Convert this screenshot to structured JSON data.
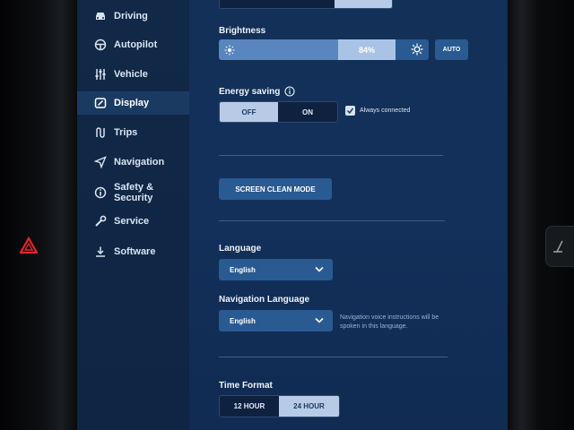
{
  "sidebar": {
    "items": [
      {
        "label": "Driving",
        "icon": "car-icon"
      },
      {
        "label": "Autopilot",
        "icon": "steering-wheel-icon"
      },
      {
        "label": "Vehicle",
        "icon": "sliders-icon"
      },
      {
        "label": "Display",
        "icon": "display-icon",
        "active": true
      },
      {
        "label": "Trips",
        "icon": "trips-icon"
      },
      {
        "label": "Navigation",
        "icon": "navigation-arrow-icon"
      },
      {
        "label": "Safety &",
        "label2": "Security",
        "icon": "info-circle-icon"
      },
      {
        "label": "Service",
        "icon": "wrench-icon"
      },
      {
        "label": "Software",
        "icon": "download-icon"
      }
    ]
  },
  "brightness": {
    "label": "Brightness",
    "value_text": "84%",
    "level": 0.84,
    "auto_label": "AUTO"
  },
  "energy_saving": {
    "label": "Energy saving",
    "options": [
      "OFF",
      "ON"
    ],
    "selected": "OFF",
    "always_connected_label": "Always connected",
    "always_connected_checked": true
  },
  "screen_clean": {
    "label": "SCREEN CLEAN MODE"
  },
  "language": {
    "label": "Language",
    "value": "English"
  },
  "navigation_language": {
    "label": "Navigation Language",
    "value": "English",
    "note_line1": "Navigation voice instructions will be",
    "note_line2": "spoken in this language."
  },
  "time_format": {
    "label": "Time Format",
    "options": [
      "12 HOUR",
      "24 HOUR"
    ],
    "selected": "24 HOUR"
  },
  "colors": {
    "screen_bg": "#12305a",
    "accent": "#2a5a92",
    "selected_segment": "#b7cbe6"
  }
}
